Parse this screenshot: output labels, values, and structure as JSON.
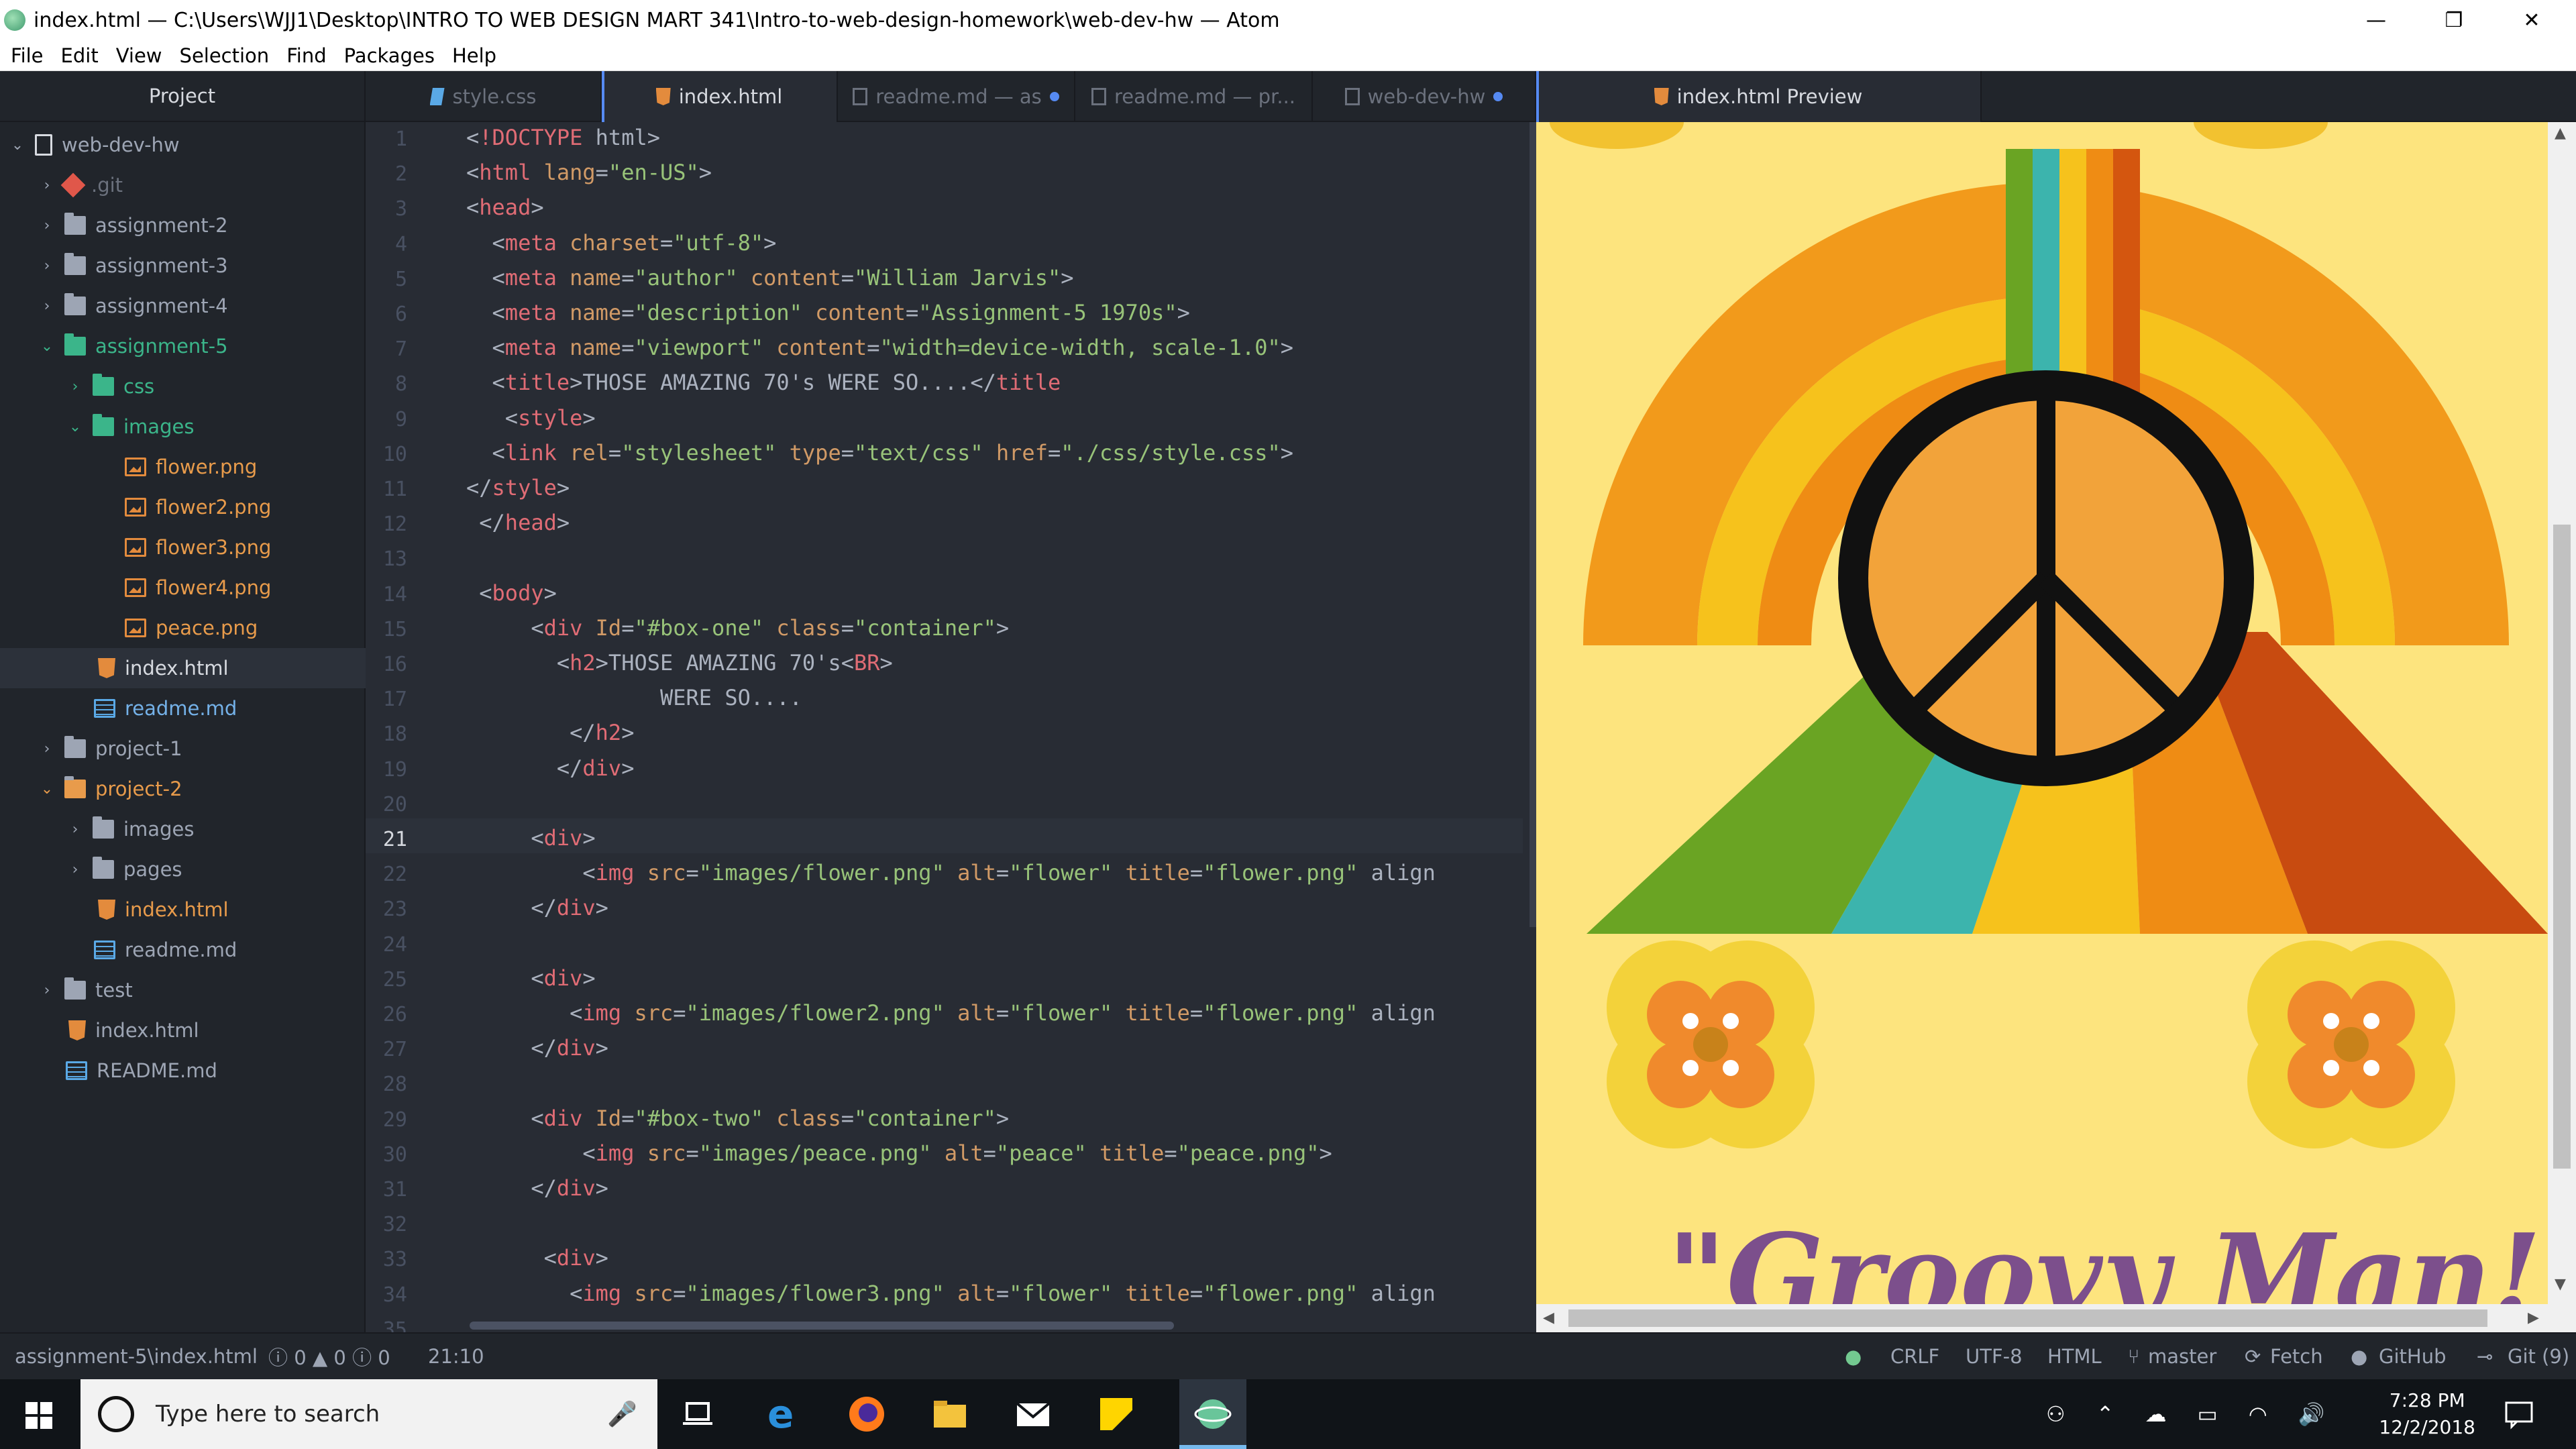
{
  "window": {
    "title": "index.html — C:\\Users\\WJJ1\\Desktop\\INTRO TO WEB DESIGN MART 341\\Intro-to-web-design-homework\\web-dev-hw — Atom",
    "minimize": "—",
    "restore": "❐",
    "close": "✕"
  },
  "menu": [
    "File",
    "Edit",
    "View",
    "Selection",
    "Find",
    "Packages",
    "Help"
  ],
  "tree": {
    "header": "Project",
    "items": [
      {
        "label": "web-dev-hw",
        "chev": "⌄"
      },
      {
        "label": ".git",
        "chev": "›"
      },
      {
        "label": "assignment-2",
        "chev": "›"
      },
      {
        "label": "assignment-3",
        "chev": "›"
      },
      {
        "label": "assignment-4",
        "chev": "›"
      },
      {
        "label": "assignment-5",
        "chev": "⌄"
      },
      {
        "label": "css",
        "chev": "›"
      },
      {
        "label": "images",
        "chev": "⌄"
      },
      {
        "label": "flower.png"
      },
      {
        "label": "flower2.png"
      },
      {
        "label": "flower3.png"
      },
      {
        "label": "flower4.png"
      },
      {
        "label": "peace.png"
      },
      {
        "label": "index.html"
      },
      {
        "label": "readme.md"
      },
      {
        "label": "project-1",
        "chev": "›"
      },
      {
        "label": "project-2",
        "chev": "⌄"
      },
      {
        "label": "images",
        "chev": "›"
      },
      {
        "label": "pages",
        "chev": "›"
      },
      {
        "label": "index.html"
      },
      {
        "label": "readme.md"
      },
      {
        "label": "test",
        "chev": "›"
      },
      {
        "label": "index.html"
      },
      {
        "label": "README.md"
      }
    ]
  },
  "tabs": [
    {
      "label": "style.css"
    },
    {
      "label": "index.html"
    },
    {
      "label": "readme.md — as"
    },
    {
      "label": "readme.md — pr..."
    },
    {
      "label": "web-dev-hw"
    },
    {
      "label": "index.html Preview"
    }
  ],
  "editor": {
    "line_numbers": [
      "1",
      "2",
      "3",
      "4",
      "5",
      "6",
      "7",
      "8",
      "9",
      "10",
      "11",
      "12",
      "13",
      "14",
      "15",
      "16",
      "17",
      "18",
      "19",
      "20",
      "21",
      "22",
      "23",
      "24",
      "25",
      "26",
      "27",
      "28",
      "29",
      "30",
      "31",
      "32",
      "33",
      "34",
      "35"
    ],
    "lines": [
      "<!DOCTYPE html>",
      "<html lang=\"en-US\">",
      "<head>",
      "  <meta charset=\"utf-8\">",
      "  <meta name=\"author\" content=\"William Jarvis\">",
      "  <meta name=\"description\" content=\"Assignment-5 1970s\">",
      "  <meta name=\"viewport\" content=\"width=device-width, scale-1.0\">",
      "  <title>THOSE AMAZING 70's WERE SO....</title",
      "   <style>",
      "  <link rel=\"stylesheet\" type=\"text/css\" href=\"./css/style.css\">",
      "</style>",
      " </head>",
      "",
      " <body>",
      "     <div Id=\"#box-one\" class=\"container\">",
      "       <h2>THOSE AMAZING 70's<BR>",
      "               WERE SO....",
      "        </h2>",
      "       </div>",
      "",
      "     <div>",
      "         <img src=\"images/flower.png\" alt=\"flower\" title=\"flower.png\" align",
      "     </div>",
      "",
      "     <div>",
      "        <img src=\"images/flower2.png\" alt=\"flower\" title=\"flower.png\" align",
      "     </div>",
      "",
      "     <div Id=\"#box-two\" class=\"container\">",
      "         <img src=\"images/peace.png\" alt=\"peace\" title=\"peace.png\">",
      "     </div>",
      "",
      "      <div>",
      "        <img src=\"images/flower3.png\" alt=\"flower\" title=\"flower.png\" align",
      ""
    ]
  },
  "preview": {
    "heading": "\"Groovy Man!\""
  },
  "status": {
    "path": "assignment-5\\index.html",
    "diagnostics": "ⓘ 0 ▲ 0 ⓘ 0",
    "cursor": "21:10",
    "line_ending": "CRLF",
    "encoding": "UTF-8",
    "grammar": "HTML",
    "branch": "master",
    "fetch": "Fetch",
    "github": "GitHub",
    "git": "Git (9)"
  },
  "taskbar": {
    "search_placeholder": "Type here to search",
    "time": "7:28 PM",
    "date": "12/2/2018"
  },
  "colors": {
    "accent": "#568af2",
    "tag": "#e06c75",
    "attr": "#d19a66",
    "string": "#98c379",
    "preview_bg": "#fde47e",
    "groovy_text": "#7c4f8c"
  }
}
